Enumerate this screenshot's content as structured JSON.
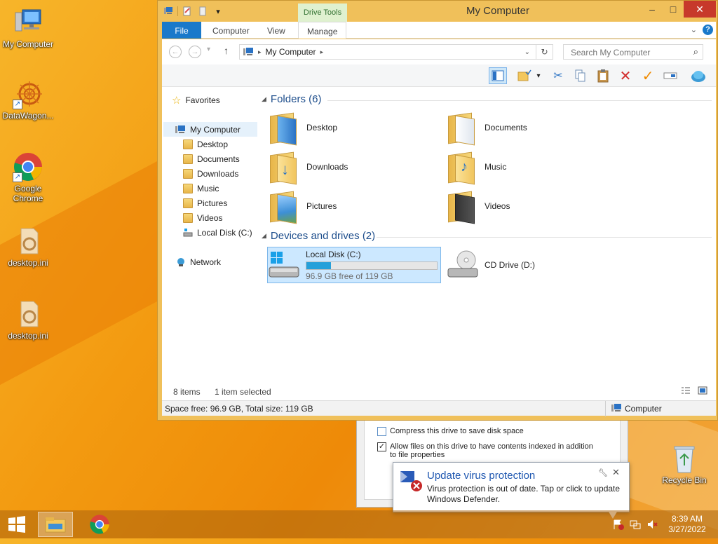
{
  "desktop": {
    "icons": [
      {
        "label": "My Computer"
      },
      {
        "label": "DataWagon..."
      },
      {
        "label": "Google Chrome"
      },
      {
        "label": "desktop.ini"
      },
      {
        "label": "desktop.ini"
      },
      {
        "label": "Recycle Bin"
      }
    ]
  },
  "window": {
    "title": "My Computer",
    "context_tab": "Drive Tools",
    "ribbon_tabs": [
      "File",
      "Computer",
      "View",
      "Manage"
    ],
    "address": {
      "crumb": "My Computer"
    },
    "search_placeholder": "Search My Computer",
    "nav": {
      "favorites": "Favorites",
      "my_computer": "My Computer",
      "children": [
        "Desktop",
        "Documents",
        "Downloads",
        "Music",
        "Pictures",
        "Videos",
        "Local Disk (C:)"
      ],
      "network": "Network"
    },
    "folders_header": "Folders (6)",
    "folders": [
      "Desktop",
      "Documents",
      "Downloads",
      "Music",
      "Pictures",
      "Videos"
    ],
    "drives_header": "Devices and drives (2)",
    "drives": [
      {
        "name": "Local Disk (C:)",
        "free_text": "96.9 GB free of 119 GB",
        "used_fraction": 0.186
      },
      {
        "name": "CD Drive (D:)"
      }
    ],
    "status": {
      "items": "8 items",
      "selected": "1 item selected"
    },
    "details": {
      "space": "Space free: 96.9 GB, Total size: 119 GB",
      "location": "Computer"
    }
  },
  "properties": {
    "compress": "Compress this drive to save disk space",
    "index": "Allow files on this drive to have contents indexed in addition to file properties"
  },
  "toast": {
    "title": "Update virus protection",
    "body": "Virus protection is out of date. Tap or click to update Windows Defender."
  },
  "taskbar": {
    "time": "8:39 AM",
    "date": "3/27/2022"
  },
  "colors": {
    "accent": "#1979ca",
    "drive_fill": "#26a0da",
    "selection": "#cce8ff"
  }
}
